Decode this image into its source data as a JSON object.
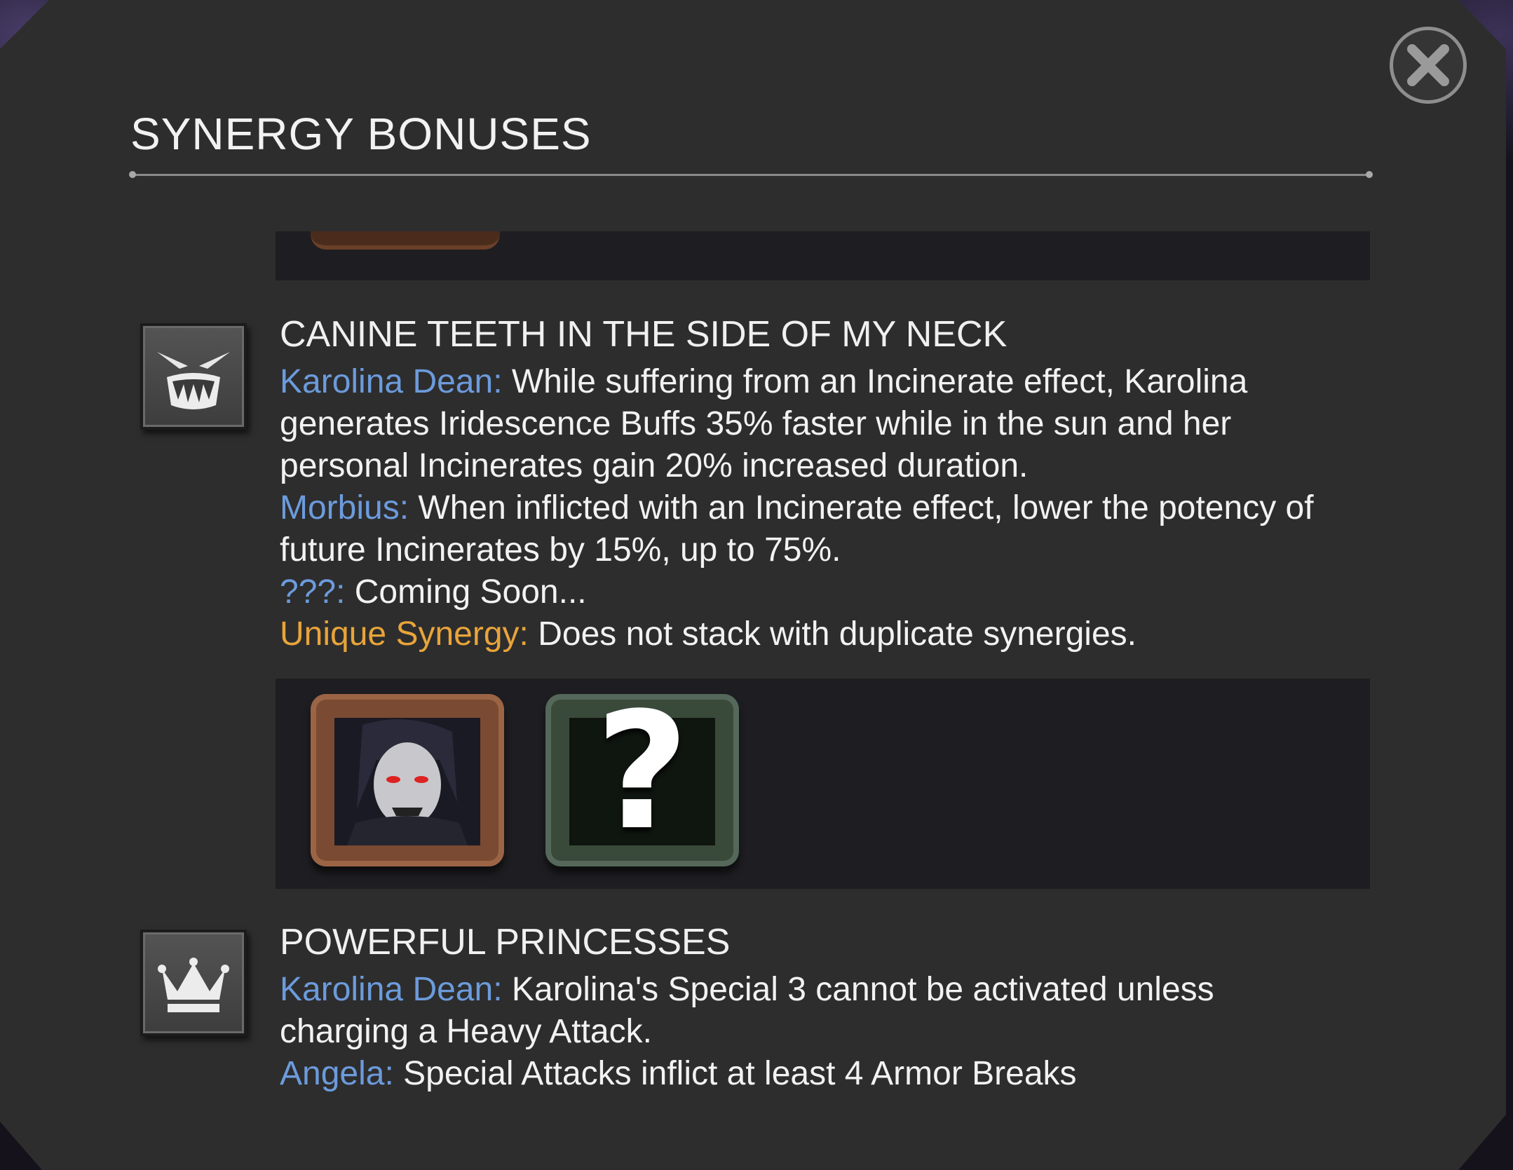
{
  "dialog": {
    "title": "SYNERGY BONUSES",
    "close_icon": "close-x-icon"
  },
  "synergies": [
    {
      "icon": "fangs-icon",
      "title": "CANINE TEETH IN THE SIDE OF MY NECK",
      "effects": [
        {
          "label": "Karolina Dean:",
          "text": "While suffering from an Incinerate effect, Karolina generates Iridescence Buffs 35% faster while in the sun and her personal Incinerates gain 20% increased duration."
        },
        {
          "label": "Morbius:",
          "text": "When inflicted with an Incinerate effect, lower the potency of future Incinerates by 15%, up to 75%."
        },
        {
          "label": "???:",
          "text": "Coming Soon..."
        },
        {
          "label": "Unique Synergy:",
          "text": "Does not stack with duplicate synergies."
        }
      ],
      "champions": [
        {
          "name": "morbius-portrait"
        },
        {
          "name": "unknown-champion",
          "glyph": "?"
        }
      ]
    },
    {
      "icon": "crown-icon",
      "title": "POWERFUL PRINCESSES",
      "effects": [
        {
          "label": "Karolina Dean:",
          "text": "Karolina's Special 3 cannot be activated unless charging a Heavy Attack."
        },
        {
          "label": "Angela:",
          "text": "Special Attacks inflict at least 4 Armor Breaks"
        }
      ]
    }
  ],
  "colors": {
    "label_blue": "#6c9bdc",
    "label_gold": "#e8a43a",
    "panel_bg": "#2d2d2d"
  }
}
